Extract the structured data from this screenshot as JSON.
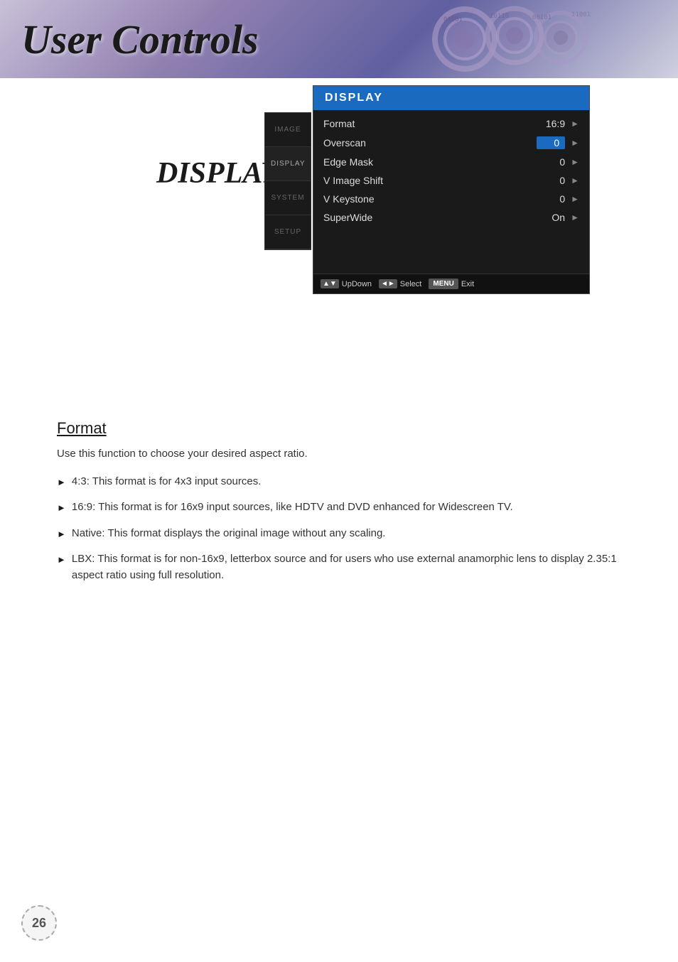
{
  "header": {
    "title": "User Controls",
    "background_color": "#b0a8c8"
  },
  "osd": {
    "title": "DISPLAY",
    "sidebar_items": [
      {
        "label": "IMAGE",
        "active": false
      },
      {
        "label": "DISPLAY",
        "active": true
      },
      {
        "label": "SYSTEM",
        "active": false
      },
      {
        "label": "SETUP",
        "active": false
      }
    ],
    "menu_rows": [
      {
        "label": "Format",
        "value": "16:9",
        "highlighted": false
      },
      {
        "label": "Overscan",
        "value": "0",
        "highlighted": true
      },
      {
        "label": "Edge Mask",
        "value": "0",
        "highlighted": false
      },
      {
        "label": "V Image Shift",
        "value": "0",
        "highlighted": false
      },
      {
        "label": "V Keystone",
        "value": "0",
        "highlighted": false
      },
      {
        "label": "SuperWide",
        "value": "On",
        "highlighted": false
      }
    ],
    "footer": {
      "updown_label": "UpDown",
      "select_label": "Select",
      "menu_label": "MENU",
      "exit_label": "Exit"
    }
  },
  "display_label": "DISPLAY",
  "content": {
    "section_title": "Format",
    "intro": "Use this function to choose your desired aspect ratio.",
    "bullets": [
      {
        "text": "4:3: This format is for 4x3 input sources."
      },
      {
        "text": "16:9: This format is for 16x9 input sources, like HDTV and DVD enhanced for Widescreen TV."
      },
      {
        "text": "Native: This format displays the original image without any scaling."
      },
      {
        "text": "LBX: This format is for non-16x9, letterbox source and for users who use external anamorphic lens to display 2.35:1 aspect ratio using full resolution."
      }
    ]
  },
  "page_number": "26"
}
